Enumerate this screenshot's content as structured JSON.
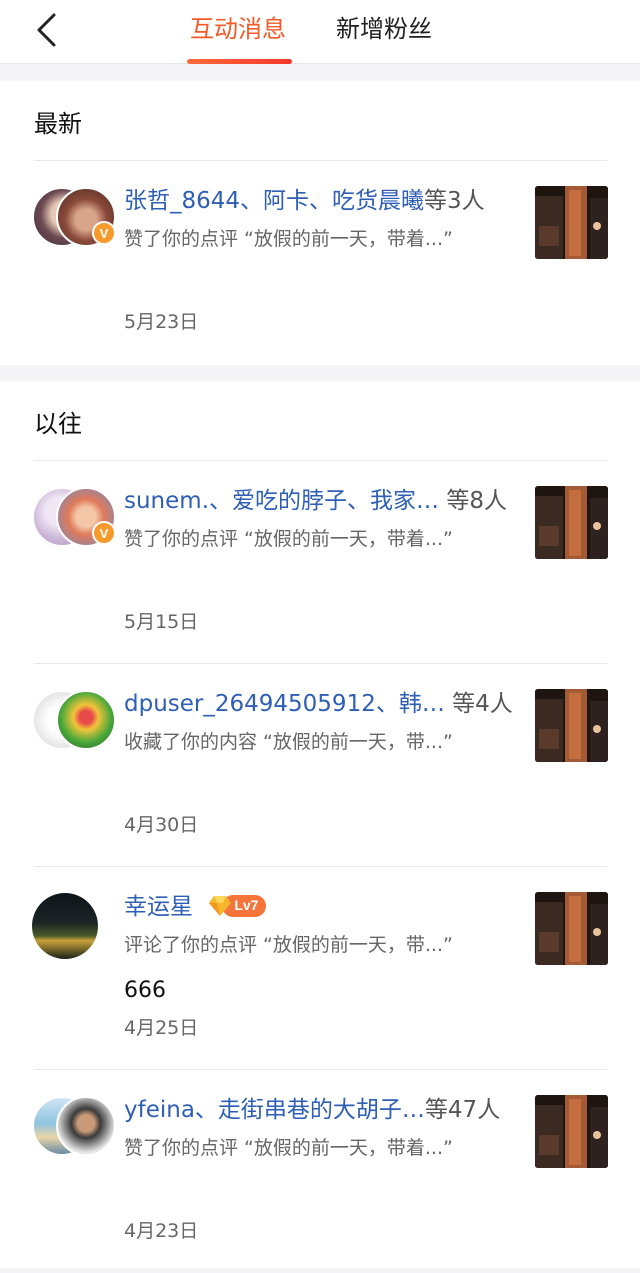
{
  "header": {
    "tabs": [
      {
        "label": "互动消息",
        "active": true
      },
      {
        "label": "新增粉丝",
        "active": false
      }
    ],
    "accent_color": "#f25a26"
  },
  "sections": [
    {
      "title": "最新",
      "items": [
        {
          "names": "张哲_8644、阿卡、吃货晨曦",
          "suffix": "等3人",
          "description": "赞了你的点评 “放假的前一天，带着...”",
          "date": "5月23日",
          "badge": "V"
        }
      ]
    },
    {
      "title": "以往",
      "items": [
        {
          "names": "sunem.、爱吃的脖子、我家…",
          "suffix": " 等8人",
          "description": "赞了你的点评 “放假的前一天，带着...”",
          "date": "5月15日",
          "badge": "V"
        },
        {
          "names": "dpuser_26494505912、韩…",
          "suffix": " 等4人",
          "description": "收藏了你的内容 “放假的前一天，带...”",
          "date": "4月30日"
        },
        {
          "names": "幸运星",
          "suffix": "",
          "level": "Lv7",
          "description": "评论了你的点评 “放假的前一天，带...”",
          "comment": "666",
          "date": "4月25日"
        },
        {
          "names": "yfeina、走街串巷的大胡子…",
          "suffix": "等47人",
          "description": "赞了你的点评 “放假的前一天，带着...”",
          "date": "4月23日"
        }
      ]
    }
  ]
}
